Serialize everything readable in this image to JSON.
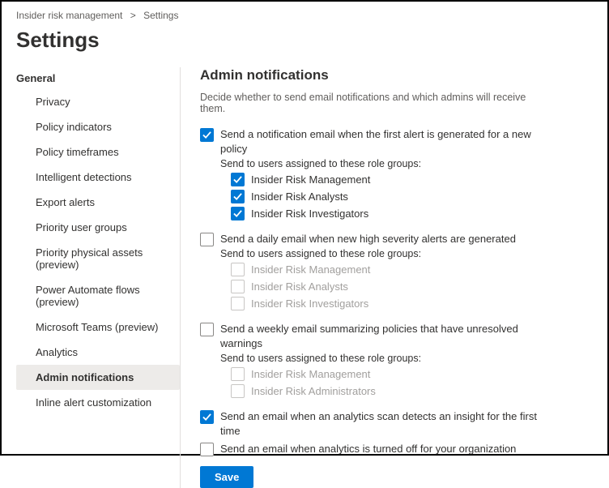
{
  "breadcrumb": {
    "parent": "Insider risk management",
    "current": "Settings"
  },
  "pageTitle": "Settings",
  "sidebar": {
    "header": "General",
    "items": [
      {
        "label": "Privacy"
      },
      {
        "label": "Policy indicators"
      },
      {
        "label": "Policy timeframes"
      },
      {
        "label": "Intelligent detections"
      },
      {
        "label": "Export alerts"
      },
      {
        "label": "Priority user groups"
      },
      {
        "label": "Priority physical assets (preview)"
      },
      {
        "label": "Power Automate flows (preview)"
      },
      {
        "label": "Microsoft Teams (preview)"
      },
      {
        "label": "Analytics"
      },
      {
        "label": "Admin notifications",
        "active": true
      },
      {
        "label": "Inline alert customization"
      }
    ]
  },
  "content": {
    "title": "Admin notifications",
    "desc": "Decide whether to send email notifications and which admins will receive them.",
    "firstAlert": {
      "label": "Send a notification email when the first alert is generated for a new policy",
      "sub": "Send to users assigned to these role groups:",
      "roles": [
        {
          "label": "Insider Risk Management",
          "checked": true
        },
        {
          "label": "Insider Risk Analysts",
          "checked": true
        },
        {
          "label": "Insider Risk Investigators",
          "checked": true
        }
      ]
    },
    "dailyHigh": {
      "label": "Send a daily email when new high severity alerts are generated",
      "sub": "Send to users assigned to these role groups:",
      "roles": [
        {
          "label": "Insider Risk Management"
        },
        {
          "label": "Insider Risk Analysts"
        },
        {
          "label": "Insider Risk Investigators"
        }
      ]
    },
    "weeklyWarn": {
      "label": "Send a weekly email summarizing policies that have unresolved warnings",
      "sub": "Send to users assigned to these role groups:",
      "roles": [
        {
          "label": "Insider Risk Management"
        },
        {
          "label": "Insider Risk Administrators"
        }
      ]
    },
    "analyticsInsight": "Send an email when an analytics scan detects an insight for the first time",
    "analyticsOff": "Send an email when analytics is turned off for your organization",
    "saveLabel": "Save"
  }
}
